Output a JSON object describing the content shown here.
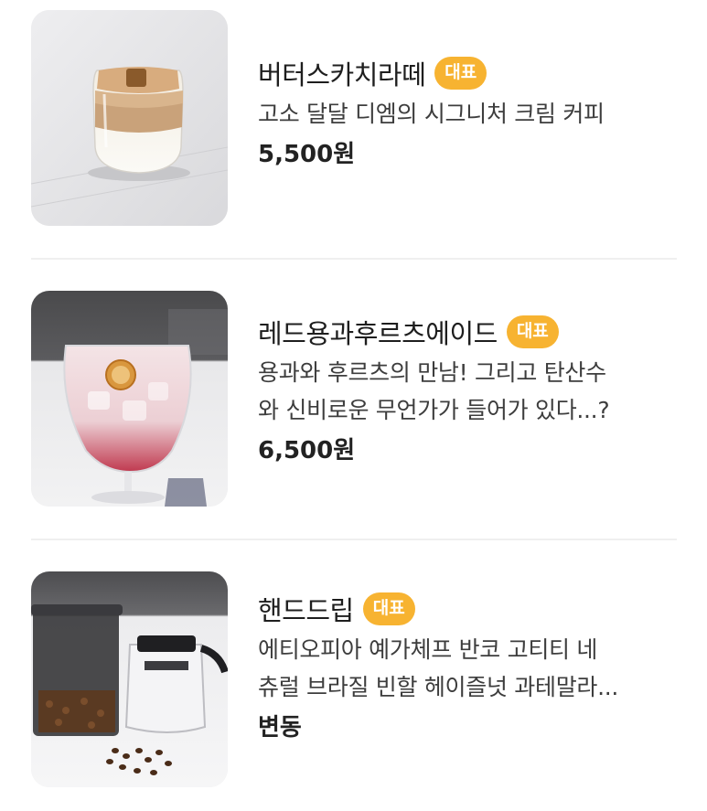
{
  "menu": {
    "items": [
      {
        "name": "버터스카치라떼",
        "badge": "대표",
        "description_lines": [
          "고소 달달 디엠의 시그니처 크림 커피"
        ],
        "price": "5,500원",
        "image_icon": "butterscotch-latte-photo"
      },
      {
        "name": "레드용과후르츠에이드",
        "badge": "대표",
        "description_lines": [
          "용과와 후르츠의 만남! 그리고 탄산수",
          "와 신비로운 무언가가 들어가 있다...?"
        ],
        "price": "6,500원",
        "image_icon": "dragonfruit-ade-photo"
      },
      {
        "name": "핸드드립",
        "badge": "대표",
        "description_lines": [
          "에티오피아 예가체프 반코 고티티 네",
          "츄럴 브라질 빈할 헤이즐넛 과테말라..."
        ],
        "price": "변동",
        "image_icon": "hand-drip-photo"
      }
    ]
  },
  "colors": {
    "badge": "#f7b331",
    "divider": "#efefef",
    "text": "#222222"
  }
}
